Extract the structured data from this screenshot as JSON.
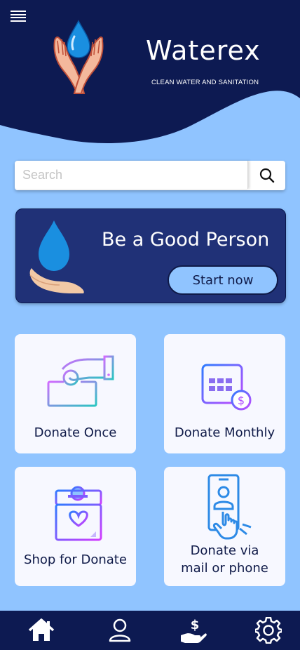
{
  "header": {
    "brand": "Waterex",
    "tagline": "CLEAN WATER AND SANITATION",
    "menu_icon": "hamburger-menu-icon",
    "logo_icon": "water-drop-hands-logo"
  },
  "search": {
    "placeholder": "Search",
    "value": "",
    "icon": "search-icon"
  },
  "banner": {
    "title": "Be a Good Person",
    "button_label": "Start now",
    "icon": "water-drop-hand-icon"
  },
  "cards": [
    {
      "label": "Donate Once",
      "icon": "donation-box-hand-icon"
    },
    {
      "label": "Donate Monthly",
      "icon": "calendar-dollar-icon"
    },
    {
      "label": "Shop for Donate",
      "icon": "charity-box-heart-icon"
    },
    {
      "label_line1": "Donate via",
      "label_line2": "mail or phone",
      "icon": "phone-tap-icon"
    }
  ],
  "nav": [
    {
      "name": "home",
      "icon": "home-icon"
    },
    {
      "name": "profile",
      "icon": "user-icon"
    },
    {
      "name": "donate",
      "icon": "hand-dollar-icon"
    },
    {
      "name": "settings",
      "icon": "gear-icon"
    }
  ],
  "colors": {
    "background": "#90c4ff",
    "navy": "#0d1a52",
    "banner": "#203177",
    "card": "#f7f8ff",
    "drop_blue": "#1a8fe0"
  }
}
